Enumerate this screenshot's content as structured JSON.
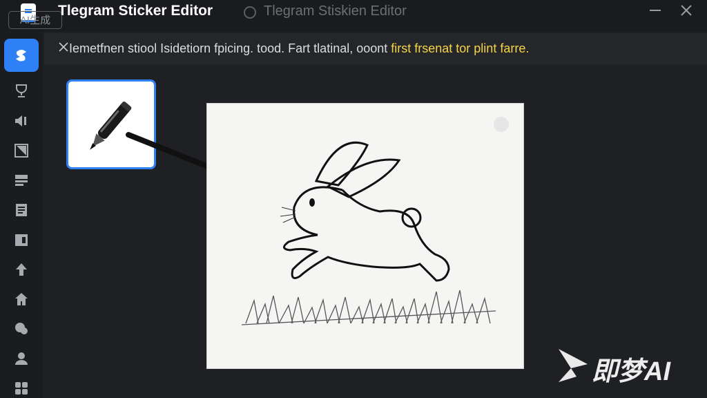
{
  "app": {
    "title": "Tlegram Sticker Editor",
    "ghost_title": "Tlegram Stiskien Editor",
    "ai_badge": "AI生成"
  },
  "window": {
    "minimize_icon": "minimize-icon",
    "close_icon": "close-icon"
  },
  "notice": {
    "text": "Iemetfnen stiool Isidetiorn fpicing. tood. Fart tlatinal, ooont ",
    "highlight": "first frsenat tor plint farre."
  },
  "sidebar": {
    "items": [
      {
        "name": "sticker-tool",
        "icon": "sticker-icon",
        "active": true
      },
      {
        "name": "trophy",
        "icon": "trophy-icon"
      },
      {
        "name": "sound",
        "icon": "speaker-icon"
      },
      {
        "name": "frame",
        "icon": "frame-icon"
      },
      {
        "name": "layers",
        "icon": "layers-icon"
      },
      {
        "name": "document",
        "icon": "document-icon"
      },
      {
        "name": "album",
        "icon": "album-icon"
      },
      {
        "name": "upload",
        "icon": "upload-icon"
      },
      {
        "name": "home",
        "icon": "home-icon"
      },
      {
        "name": "chat",
        "icon": "chat-icon"
      },
      {
        "name": "user",
        "icon": "user-icon"
      },
      {
        "name": "apps",
        "icon": "apps-icon"
      }
    ]
  },
  "tool": {
    "selected": "pen-icon"
  },
  "canvas": {
    "content": "rabbit-sketch"
  },
  "watermark": {
    "text": "即梦AI"
  },
  "colors": {
    "accent": "#2f80f5",
    "highlight": "#f5d547",
    "background": "#1f2023"
  }
}
